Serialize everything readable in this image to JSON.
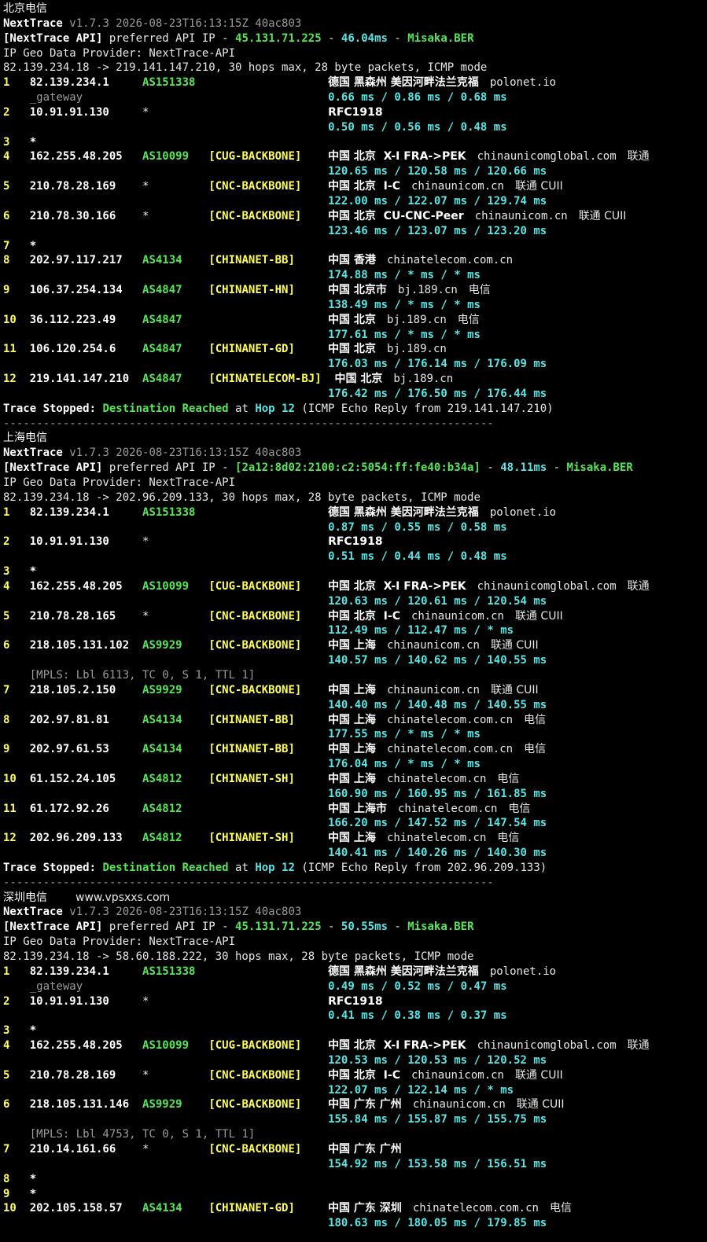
{
  "blocks": [
    {
      "title": "北京电信",
      "watermark": "",
      "version_line": {
        "name": "NextTrace",
        "version": "v1.7.3 2026-08-23T16:13:15Z 40ac803"
      },
      "api_line": {
        "tag": "[NextTrace API]",
        "mid": " preferred API IP - ",
        "ip": "45.131.71.225",
        "sep1": " - ",
        "latency": "46.04ms",
        "sep2": " - ",
        "node": "Misaka.BER"
      },
      "provider_line": "IP Geo Data Provider: NextTrace-API",
      "route_line": "82.139.234.18 -> 219.141.147.210, 30 hops max, 28 byte packets, ICMP mode",
      "hops": [
        {
          "num": "1",
          "ip": "82.139.234.1",
          "asn": "AS151338",
          "tag": "",
          "geo": "德国 黑森州 美因河畔法兰克福",
          "domain": "polonet.io",
          "isp": "",
          "sub": "_gateway",
          "times": [
            "0.66",
            "0.86",
            "0.68"
          ]
        },
        {
          "num": "2",
          "ip": "10.91.91.130",
          "asn": "*",
          "tag": "",
          "geo": "RFC1918",
          "domain": "",
          "isp": "",
          "sub": "",
          "times": [
            "0.50",
            "0.56",
            "0.48"
          ]
        },
        {
          "num": "3",
          "ip": "*",
          "asn": "",
          "tag": "",
          "geo": "",
          "domain": "",
          "isp": "",
          "sub": "",
          "times": []
        },
        {
          "num": "4",
          "ip": "162.255.48.205",
          "asn": "AS10099",
          "tag": "[CUG-BACKBONE]",
          "geo": "中国 北京  X-I FRA->PEK",
          "domain": "chinaunicomglobal.com",
          "isp": "联通",
          "sub": "",
          "times": [
            "120.65",
            "120.58",
            "120.66"
          ]
        },
        {
          "num": "5",
          "ip": "210.78.28.169",
          "asn": "*",
          "tag": "[CNC-BACKBONE]",
          "geo": "中国 北京  I-C",
          "domain": "chinaunicom.cn",
          "isp": "联通 CUII",
          "sub": "",
          "times": [
            "122.00",
            "122.07",
            "129.74"
          ]
        },
        {
          "num": "6",
          "ip": "210.78.30.166",
          "asn": "*",
          "tag": "[CNC-BACKBONE]",
          "geo": "中国 北京  CU-CNC-Peer",
          "domain": "chinaunicom.cn",
          "isp": "联通 CUII",
          "sub": "",
          "times": [
            "123.46",
            "123.07",
            "123.20"
          ]
        },
        {
          "num": "7",
          "ip": "*",
          "asn": "",
          "tag": "",
          "geo": "",
          "domain": "",
          "isp": "",
          "sub": "",
          "times": []
        },
        {
          "num": "8",
          "ip": "202.97.117.217",
          "asn": "AS4134",
          "tag": "[CHINANET-BB]",
          "geo": "中国 香港",
          "domain": "chinatelecom.com.cn",
          "isp": "",
          "sub": "",
          "times": [
            "174.88",
            "*",
            "*"
          ]
        },
        {
          "num": "9",
          "ip": "106.37.254.134",
          "asn": "AS4847",
          "tag": "[CHINANET-HN]",
          "geo": "中国 北京市",
          "domain": "bj.189.cn",
          "isp": "电信",
          "sub": "",
          "times": [
            "138.49",
            "*",
            "*"
          ]
        },
        {
          "num": "10",
          "ip": "36.112.223.49",
          "asn": "AS4847",
          "tag": "",
          "geo": "中国 北京",
          "domain": "bj.189.cn",
          "isp": "电信",
          "sub": "",
          "times": [
            "177.61",
            "*",
            "*"
          ]
        },
        {
          "num": "11",
          "ip": "106.120.254.6",
          "asn": "AS4847",
          "tag": "[CHINANET-GD]",
          "geo": "中国 北京",
          "domain": "bj.189.cn",
          "isp": "",
          "sub": "",
          "times": [
            "176.03",
            "176.14",
            "176.09"
          ]
        },
        {
          "num": "12",
          "ip": "219.141.147.210",
          "asn": "AS4847",
          "tag": "[CHINATELECOM-BJ]",
          "geo": "中国 北京",
          "domain": "bj.189.cn",
          "isp": "",
          "sub": "",
          "times": [
            "176.42",
            "176.50",
            "176.44"
          ]
        }
      ],
      "stop": {
        "a": "Trace Stopped:",
        "b": "Destination Reached",
        "c": "at",
        "d": "Hop 12",
        "e": "(ICMP Echo Reply from 219.141.147.210)"
      }
    },
    {
      "title": "上海电信",
      "watermark": "",
      "version_line": {
        "name": "NextTrace",
        "version": "v1.7.3 2026-08-23T16:13:15Z 40ac803"
      },
      "api_line": {
        "tag": "[NextTrace API]",
        "mid": " preferred API IP - ",
        "ip": "[2a12:8d02:2100:c2:5054:ff:fe40:b34a]",
        "sep1": " - ",
        "latency": "48.11ms",
        "sep2": " - ",
        "node": "Misaka.BER"
      },
      "provider_line": "IP Geo Data Provider: NextTrace-API",
      "route_line": "82.139.234.18 -> 202.96.209.133, 30 hops max, 28 byte packets, ICMP mode",
      "hops": [
        {
          "num": "1",
          "ip": "82.139.234.1",
          "asn": "AS151338",
          "tag": "",
          "geo": "德国 黑森州 美因河畔法兰克福",
          "domain": "polonet.io",
          "isp": "",
          "sub": "",
          "times": [
            "0.87",
            "0.55",
            "0.58"
          ]
        },
        {
          "num": "2",
          "ip": "10.91.91.130",
          "asn": "*",
          "tag": "",
          "geo": "RFC1918",
          "domain": "",
          "isp": "",
          "sub": "",
          "times": [
            "0.51",
            "0.44",
            "0.48"
          ]
        },
        {
          "num": "3",
          "ip": "*",
          "asn": "",
          "tag": "",
          "geo": "",
          "domain": "",
          "isp": "",
          "sub": "",
          "times": []
        },
        {
          "num": "4",
          "ip": "162.255.48.205",
          "asn": "AS10099",
          "tag": "[CUG-BACKBONE]",
          "geo": "中国 北京  X-I FRA->PEK",
          "domain": "chinaunicomglobal.com",
          "isp": "联通",
          "sub": "",
          "times": [
            "120.63",
            "120.61",
            "120.54"
          ]
        },
        {
          "num": "5",
          "ip": "210.78.28.165",
          "asn": "*",
          "tag": "[CNC-BACKBONE]",
          "geo": "中国 北京  I-C",
          "domain": "chinaunicom.cn",
          "isp": "联通 CUII",
          "sub": "",
          "times": [
            "112.49",
            "112.47",
            "*"
          ]
        },
        {
          "num": "6",
          "ip": "218.105.131.102",
          "asn": "AS9929",
          "tag": "[CNC-BACKBONE]",
          "geo": "中国 上海",
          "domain": "chinaunicom.cn",
          "isp": "联通 CUII",
          "sub": "[MPLS: Lbl 6113, TC 0, S 1, TTL 1]",
          "times": [
            "140.57",
            "140.62",
            "140.55"
          ]
        },
        {
          "num": "7",
          "ip": "218.105.2.150",
          "asn": "AS9929",
          "tag": "[CNC-BACKBONE]",
          "geo": "中国 上海",
          "domain": "chinaunicom.cn",
          "isp": "联通 CUII",
          "sub": "",
          "times": [
            "140.40",
            "140.48",
            "140.55"
          ]
        },
        {
          "num": "8",
          "ip": "202.97.81.81",
          "asn": "AS4134",
          "tag": "[CHINANET-BB]",
          "geo": "中国 上海",
          "domain": "chinatelecom.com.cn",
          "isp": "电信",
          "sub": "",
          "times": [
            "177.55",
            "*",
            "*"
          ]
        },
        {
          "num": "9",
          "ip": "202.97.61.53",
          "asn": "AS4134",
          "tag": "[CHINANET-BB]",
          "geo": "中国 上海",
          "domain": "chinatelecom.com.cn",
          "isp": "电信",
          "sub": "",
          "times": [
            "176.04",
            "*",
            "*"
          ]
        },
        {
          "num": "10",
          "ip": "61.152.24.105",
          "asn": "AS4812",
          "tag": "[CHINANET-SH]",
          "geo": "中国 上海",
          "domain": "chinatelecom.cn",
          "isp": "电信",
          "sub": "",
          "times": [
            "160.90",
            "160.95",
            "161.85"
          ]
        },
        {
          "num": "11",
          "ip": "61.172.92.26",
          "asn": "AS4812",
          "tag": "",
          "geo": "中国 上海市",
          "domain": "chinatelecom.cn",
          "isp": "电信",
          "sub": "",
          "times": [
            "166.20",
            "147.52",
            "147.54"
          ]
        },
        {
          "num": "12",
          "ip": "202.96.209.133",
          "asn": "AS4812",
          "tag": "[CHINANET-SH]",
          "geo": "中国 上海",
          "domain": "chinatelecom.cn",
          "isp": "电信",
          "sub": "",
          "times": [
            "140.41",
            "140.26",
            "140.30"
          ]
        }
      ],
      "stop": {
        "a": "Trace Stopped:",
        "b": "Destination Reached",
        "c": "at",
        "d": "Hop 12",
        "e": "(ICMP Echo Reply from 202.96.209.133)"
      }
    },
    {
      "title": "深圳电信",
      "watermark": "www.vpsxxs.com",
      "version_line": {
        "name": "NextTrace",
        "version": "v1.7.3 2026-08-23T16:13:15Z 40ac803"
      },
      "api_line": {
        "tag": "[NextTrace API]",
        "mid": " preferred API IP - ",
        "ip": "45.131.71.225",
        "sep1": " - ",
        "latency": "50.55ms",
        "sep2": " - ",
        "node": "Misaka.BER"
      },
      "provider_line": "IP Geo Data Provider: NextTrace-API",
      "route_line": "82.139.234.18 -> 58.60.188.222, 30 hops max, 28 byte packets, ICMP mode",
      "hops": [
        {
          "num": "1",
          "ip": "82.139.234.1",
          "asn": "AS151338",
          "tag": "",
          "geo": "德国 黑森州 美因河畔法兰克福",
          "domain": "polonet.io",
          "isp": "",
          "sub": "_gateway",
          "times": [
            "0.49",
            "0.52",
            "0.47"
          ]
        },
        {
          "num": "2",
          "ip": "10.91.91.130",
          "asn": "*",
          "tag": "",
          "geo": "RFC1918",
          "domain": "",
          "isp": "",
          "sub": "",
          "times": [
            "0.41",
            "0.38",
            "0.37"
          ]
        },
        {
          "num": "3",
          "ip": "*",
          "asn": "",
          "tag": "",
          "geo": "",
          "domain": "",
          "isp": "",
          "sub": "",
          "times": []
        },
        {
          "num": "4",
          "ip": "162.255.48.205",
          "asn": "AS10099",
          "tag": "[CUG-BACKBONE]",
          "geo": "中国 北京  X-I FRA->PEK",
          "domain": "chinaunicomglobal.com",
          "isp": "联通",
          "sub": "",
          "times": [
            "120.53",
            "120.53",
            "120.52"
          ]
        },
        {
          "num": "5",
          "ip": "210.78.28.169",
          "asn": "*",
          "tag": "[CNC-BACKBONE]",
          "geo": "中国 北京  I-C",
          "domain": "chinaunicom.cn",
          "isp": "联通 CUII",
          "sub": "",
          "times": [
            "122.07",
            "122.14",
            "*"
          ]
        },
        {
          "num": "6",
          "ip": "218.105.131.146",
          "asn": "AS9929",
          "tag": "[CNC-BACKBONE]",
          "geo": "中国 广东 广州",
          "domain": "chinaunicom.cn",
          "isp": "联通 CUII",
          "sub": "[MPLS: Lbl 4753, TC 0, S 1, TTL 1]",
          "times": [
            "155.84",
            "155.87",
            "155.75"
          ]
        },
        {
          "num": "7",
          "ip": "210.14.161.66",
          "asn": "*",
          "tag": "[CNC-BACKBONE]",
          "geo": "中国 广东 广州",
          "domain": "",
          "isp": "",
          "sub": "",
          "times": [
            "154.92",
            "153.58",
            "156.51"
          ]
        },
        {
          "num": "8",
          "ip": "*",
          "asn": "",
          "tag": "",
          "geo": "",
          "domain": "",
          "isp": "",
          "sub": "",
          "times": []
        },
        {
          "num": "9",
          "ip": "*",
          "asn": "",
          "tag": "",
          "geo": "",
          "domain": "",
          "isp": "",
          "sub": "",
          "times": []
        },
        {
          "num": "10",
          "ip": "202.105.158.57",
          "asn": "AS4134",
          "tag": "[CHINANET-GD]",
          "geo": "中国 广东 深圳",
          "domain": "chinatelecom.com.cn",
          "isp": "电信",
          "sub": "",
          "times": [
            "180.63",
            "180.05",
            "179.85"
          ]
        }
      ]
    }
  ],
  "separator": "--------------------------------------------------------------------------",
  "colors": {
    "background": "#000000",
    "text": "#e6e6e6",
    "green": "#55e655",
    "yellow": "#ffff55",
    "cyan": "#55e6e6",
    "gray": "#9a9a9a"
  }
}
